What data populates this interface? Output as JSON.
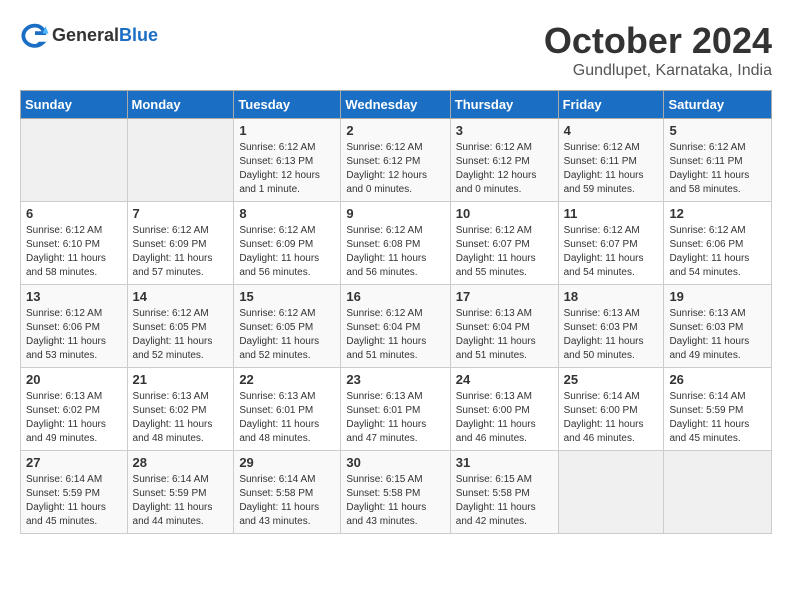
{
  "header": {
    "logo_general": "General",
    "logo_blue": "Blue",
    "month": "October 2024",
    "location": "Gundlupet, Karnataka, India"
  },
  "weekdays": [
    "Sunday",
    "Monday",
    "Tuesday",
    "Wednesday",
    "Thursday",
    "Friday",
    "Saturday"
  ],
  "weeks": [
    [
      {
        "day": "",
        "info": ""
      },
      {
        "day": "",
        "info": ""
      },
      {
        "day": "1",
        "info": "Sunrise: 6:12 AM\nSunset: 6:13 PM\nDaylight: 12 hours and 1 minute."
      },
      {
        "day": "2",
        "info": "Sunrise: 6:12 AM\nSunset: 6:12 PM\nDaylight: 12 hours and 0 minutes."
      },
      {
        "day": "3",
        "info": "Sunrise: 6:12 AM\nSunset: 6:12 PM\nDaylight: 12 hours and 0 minutes."
      },
      {
        "day": "4",
        "info": "Sunrise: 6:12 AM\nSunset: 6:11 PM\nDaylight: 11 hours and 59 minutes."
      },
      {
        "day": "5",
        "info": "Sunrise: 6:12 AM\nSunset: 6:11 PM\nDaylight: 11 hours and 58 minutes."
      }
    ],
    [
      {
        "day": "6",
        "info": "Sunrise: 6:12 AM\nSunset: 6:10 PM\nDaylight: 11 hours and 58 minutes."
      },
      {
        "day": "7",
        "info": "Sunrise: 6:12 AM\nSunset: 6:09 PM\nDaylight: 11 hours and 57 minutes."
      },
      {
        "day": "8",
        "info": "Sunrise: 6:12 AM\nSunset: 6:09 PM\nDaylight: 11 hours and 56 minutes."
      },
      {
        "day": "9",
        "info": "Sunrise: 6:12 AM\nSunset: 6:08 PM\nDaylight: 11 hours and 56 minutes."
      },
      {
        "day": "10",
        "info": "Sunrise: 6:12 AM\nSunset: 6:07 PM\nDaylight: 11 hours and 55 minutes."
      },
      {
        "day": "11",
        "info": "Sunrise: 6:12 AM\nSunset: 6:07 PM\nDaylight: 11 hours and 54 minutes."
      },
      {
        "day": "12",
        "info": "Sunrise: 6:12 AM\nSunset: 6:06 PM\nDaylight: 11 hours and 54 minutes."
      }
    ],
    [
      {
        "day": "13",
        "info": "Sunrise: 6:12 AM\nSunset: 6:06 PM\nDaylight: 11 hours and 53 minutes."
      },
      {
        "day": "14",
        "info": "Sunrise: 6:12 AM\nSunset: 6:05 PM\nDaylight: 11 hours and 52 minutes."
      },
      {
        "day": "15",
        "info": "Sunrise: 6:12 AM\nSunset: 6:05 PM\nDaylight: 11 hours and 52 minutes."
      },
      {
        "day": "16",
        "info": "Sunrise: 6:12 AM\nSunset: 6:04 PM\nDaylight: 11 hours and 51 minutes."
      },
      {
        "day": "17",
        "info": "Sunrise: 6:13 AM\nSunset: 6:04 PM\nDaylight: 11 hours and 51 minutes."
      },
      {
        "day": "18",
        "info": "Sunrise: 6:13 AM\nSunset: 6:03 PM\nDaylight: 11 hours and 50 minutes."
      },
      {
        "day": "19",
        "info": "Sunrise: 6:13 AM\nSunset: 6:03 PM\nDaylight: 11 hours and 49 minutes."
      }
    ],
    [
      {
        "day": "20",
        "info": "Sunrise: 6:13 AM\nSunset: 6:02 PM\nDaylight: 11 hours and 49 minutes."
      },
      {
        "day": "21",
        "info": "Sunrise: 6:13 AM\nSunset: 6:02 PM\nDaylight: 11 hours and 48 minutes."
      },
      {
        "day": "22",
        "info": "Sunrise: 6:13 AM\nSunset: 6:01 PM\nDaylight: 11 hours and 48 minutes."
      },
      {
        "day": "23",
        "info": "Sunrise: 6:13 AM\nSunset: 6:01 PM\nDaylight: 11 hours and 47 minutes."
      },
      {
        "day": "24",
        "info": "Sunrise: 6:13 AM\nSunset: 6:00 PM\nDaylight: 11 hours and 46 minutes."
      },
      {
        "day": "25",
        "info": "Sunrise: 6:14 AM\nSunset: 6:00 PM\nDaylight: 11 hours and 46 minutes."
      },
      {
        "day": "26",
        "info": "Sunrise: 6:14 AM\nSunset: 5:59 PM\nDaylight: 11 hours and 45 minutes."
      }
    ],
    [
      {
        "day": "27",
        "info": "Sunrise: 6:14 AM\nSunset: 5:59 PM\nDaylight: 11 hours and 45 minutes."
      },
      {
        "day": "28",
        "info": "Sunrise: 6:14 AM\nSunset: 5:59 PM\nDaylight: 11 hours and 44 minutes."
      },
      {
        "day": "29",
        "info": "Sunrise: 6:14 AM\nSunset: 5:58 PM\nDaylight: 11 hours and 43 minutes."
      },
      {
        "day": "30",
        "info": "Sunrise: 6:15 AM\nSunset: 5:58 PM\nDaylight: 11 hours and 43 minutes."
      },
      {
        "day": "31",
        "info": "Sunrise: 6:15 AM\nSunset: 5:58 PM\nDaylight: 11 hours and 42 minutes."
      },
      {
        "day": "",
        "info": ""
      },
      {
        "day": "",
        "info": ""
      }
    ]
  ]
}
